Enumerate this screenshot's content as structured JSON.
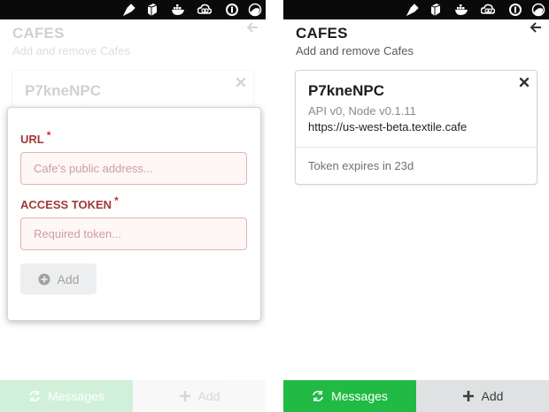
{
  "header": {
    "title": "CAFES",
    "subtitle": "Add and remove Cafes"
  },
  "cafe": {
    "name": "P7kneNPC",
    "meta": "API v0, Node v0.1.11",
    "url": "https://us-west-beta.textile.cafe",
    "expiry": "Token expires in 23d"
  },
  "form": {
    "url_label": "URL",
    "url_placeholder": "Cafe's public address...",
    "url_value": "",
    "token_label": "ACCESS TOKEN",
    "token_placeholder": "Required token...",
    "token_value": "",
    "required_mark": "*",
    "submit_label": "Add"
  },
  "footer": {
    "messages_label": "Messages",
    "add_label": "Add"
  },
  "tray_icons": [
    "pen-nib-icon",
    "cube-icon",
    "docker-whale-icon",
    "creative-cloud-icon",
    "one-password-icon",
    "half-circle-icon"
  ],
  "colors": {
    "messages_green": "#21ba45",
    "add_grey": "#e0e1e2",
    "error_red": "#9f3a38",
    "error_bg": "#fff6f6",
    "required_red": "#db2828"
  }
}
